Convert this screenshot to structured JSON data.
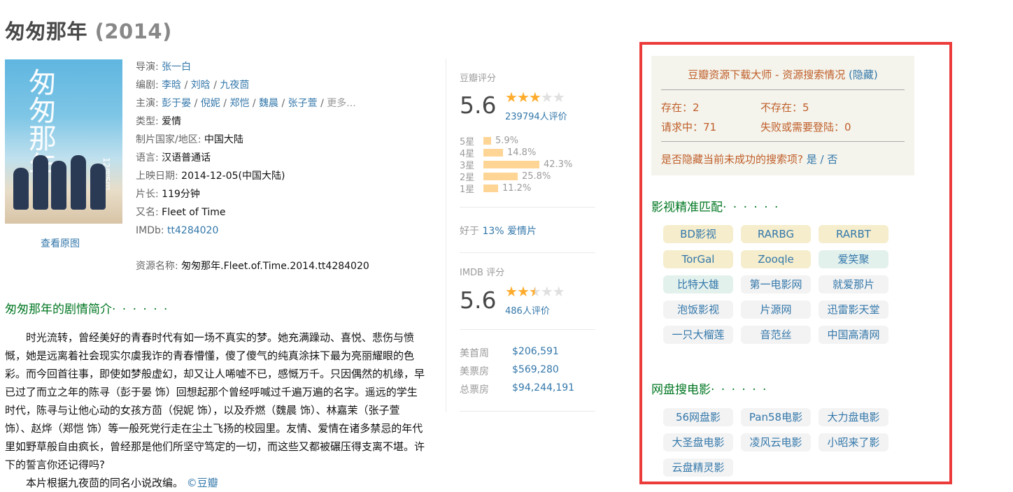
{
  "movie": {
    "title": "匆匆那年",
    "year": "(2014)"
  },
  "poster": {
    "title_text": "匆匆那年",
    "date_text": "12月5日",
    "view_link": "查看原图"
  },
  "info": {
    "director_label": "导演",
    "director": "张一白",
    "writer_label": "编剧",
    "writers": [
      "李晗",
      "刘晗",
      "九夜茴"
    ],
    "cast_label": "主演",
    "cast": [
      "彭于晏",
      "倪妮",
      "郑恺",
      "魏晨",
      "张子萱"
    ],
    "cast_more": "更多...",
    "genre_label": "类型",
    "genre": "爱情",
    "country_label": "制片国家/地区",
    "country": "中国大陆",
    "language_label": "语言",
    "language": "汉语普通话",
    "release_label": "上映日期",
    "release": "2014-12-05(中国大陆)",
    "runtime_label": "片长",
    "runtime": "119分钟",
    "aka_label": "又名",
    "aka": "Fleet of Time",
    "imdb_label": "IMDb",
    "imdb": "tt4284020",
    "resource_label": "资源名称",
    "resource": "匆匆那年.Fleet.of.Time.2014.tt4284020"
  },
  "summary": {
    "heading": "匆匆那年的剧情简介",
    "dots": "· · · · · ·",
    "text": "时光流转，曾经美好的青春时代有如一场不真实的梦。她充满躁动、喜悦、悲伤与愤慨，她是远离着社会现实尔虞我诈的青春懵懂，傻了傻气的纯真涂抹下最为亮丽耀眼的色彩。而今回首往事，即使如梦般虚幻，却又让人唏嘘不已，感慨万千。只因偶然的机缘，早已过了而立之年的陈寻（彭于晏 饰）回想起那个曾经呼喊过千遍万遍的名字。遥远的学生时代，陈寻与让他心动的女孩方茴（倪妮 饰），以及乔燃（魏晨 饰）、林嘉茉（张子萱 饰）、赵烨（郑恺 饰）等一般死党行走在尘土飞扬的校园里。友情、爱情在诸多禁忌的年代里如野草般自由疯长，曾经那是他们所坚守笃定的一切，而这些又都被碾压得支离不堪。许下的誓言你还记得吗?",
    "footer": "本片根据九夜茴的同名小说改编。",
    "footer_link": "©豆瓣"
  },
  "douban": {
    "label": "豆瓣评分",
    "score": "5.6",
    "count": "239794人评价",
    "stars": 3,
    "rows": [
      {
        "star": "5星",
        "pct": "5.9%",
        "value": 5.9
      },
      {
        "star": "4星",
        "pct": "14.8%",
        "value": 14.8
      },
      {
        "star": "3星",
        "pct": "42.3%",
        "value": 42.3
      },
      {
        "star": "2星",
        "pct": "25.8%",
        "value": 25.8
      },
      {
        "star": "1星",
        "pct": "11.2%",
        "value": 11.2
      }
    ],
    "better_prefix": "好于",
    "better_pct": "13% 爱情片"
  },
  "imdb": {
    "label": "IMDB 评分",
    "score": "5.6",
    "count": "486人评价",
    "stars": 2.5
  },
  "boxoffice": {
    "opening_label": "美首周",
    "opening": "$206,591",
    "us_label": "美票房",
    "us": "$569,280",
    "total_label": "总票房",
    "total": "$94,244,191"
  },
  "plugin": {
    "title": "豆瓣资源下载大师 - 资源搜索情况",
    "hide": "(隐藏)",
    "exist": "存在：2",
    "not_exist": "不存在：5",
    "requesting": "请求中：71",
    "failed": "失败或需要登陆：0",
    "question": "是否隐藏当前未成功的搜索项?",
    "yes": "是",
    "slash": "/",
    "no": "否",
    "section1": "影视精准匹配",
    "section2": "网盘搜电影",
    "dots": "· · · · · ·",
    "tags1": [
      "BD影视",
      "RARBG",
      "RARBT",
      "TorGal",
      "Zooqle",
      "爱笑聚",
      "比特大雄",
      "第一电影网",
      "就爱那片",
      "泡饭影视",
      "片源网",
      "迅雷影天堂",
      "一只大榴莲",
      "音范丝",
      "中国高清网"
    ],
    "tags2": [
      "56网盘影",
      "Pan58电影",
      "大力盘电影",
      "大圣盘电影",
      "凌风云电影",
      "小昭来了影",
      "云盘精灵影"
    ],
    "colors": {
      "found": "#f5edcc",
      "failed": "#e3f1ed",
      "pending": "#f3f3f3",
      "accent": "#c05e2a",
      "frame": "#ec3b3b"
    }
  }
}
